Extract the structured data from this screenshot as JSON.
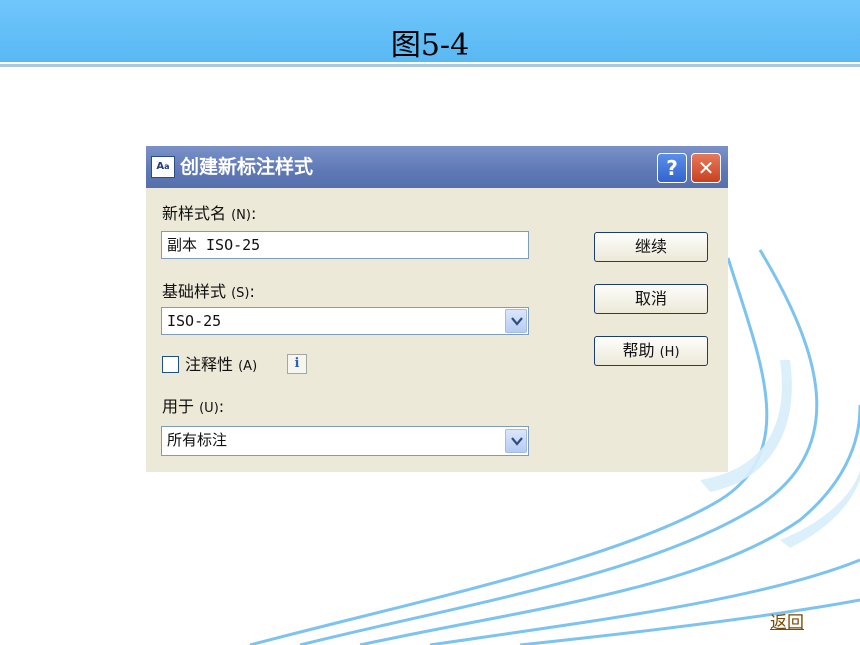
{
  "slide": {
    "title": "图5-4",
    "return_link": "返回"
  },
  "dialog": {
    "title": "创建新标注样式",
    "help_button": "?",
    "close_button": "✕",
    "new_style_name": {
      "label": "新样式名",
      "hotkey": "(N)",
      "suffix": ":",
      "value": "副本 ISO-25"
    },
    "base_style": {
      "label": "基础样式",
      "hotkey": "(S)",
      "suffix": ":",
      "value": "ISO-25"
    },
    "annotative": {
      "label": "注释性",
      "hotkey": "(A)",
      "checked": false,
      "info_icon": "i"
    },
    "use_for": {
      "label": "用于",
      "hotkey": "(U)",
      "suffix": ":",
      "value": "所有标注"
    },
    "buttons": {
      "continue": "继续",
      "cancel": "取消",
      "help": "帮助",
      "help_hotkey": "(H)"
    }
  },
  "colors": {
    "header_blue": "#5ab8f3",
    "titlebar_blue": "#5e78b6",
    "dialog_face": "#ece9d8",
    "wave_blue": "#7cc3ef"
  },
  "icons": {
    "app": "autocad-dimension-style-icon",
    "info": "info-icon",
    "dropdown": "chevron-down-icon"
  }
}
